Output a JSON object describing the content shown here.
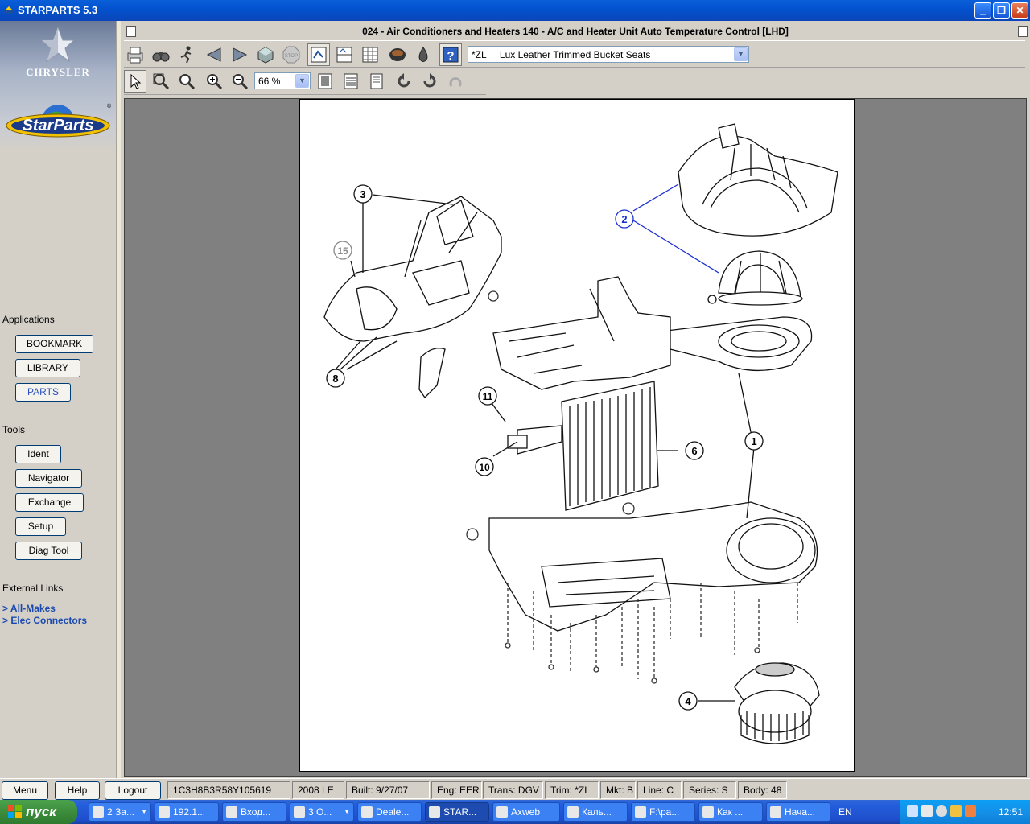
{
  "window": {
    "title": "STARPARTS 5.3",
    "min": "_",
    "max": "❐",
    "close": "✕"
  },
  "brand": {
    "chrysler": "CHRYSLER",
    "starparts": "StarParts"
  },
  "left": {
    "applications_label": "Applications",
    "applications": [
      "BOOKMARK",
      "LIBRARY",
      "PARTS"
    ],
    "tools_label": "Tools",
    "tools": [
      "Ident",
      "Navigator",
      "Exchange",
      "Setup",
      "Diag Tool"
    ],
    "external_label": "External Links",
    "external": [
      "> All-Makes",
      "> Elec Connectors"
    ]
  },
  "doc": {
    "title": "024 - Air Conditioners and Heaters   140 - A/C and Heater Unit Auto Temperature Control [LHD]"
  },
  "toolbar": {
    "trim_select": "*ZL     Lux Leather Trimmed Bucket Seats",
    "zoom": "66 %"
  },
  "diagram": {
    "callouts": [
      "3",
      "15",
      "2",
      "8",
      "11",
      "10",
      "6",
      "1",
      "4"
    ]
  },
  "status": {
    "menu": "Menu",
    "help": "Help",
    "logout": "Logout",
    "vin": "1C3H8B3R58Y105619",
    "year_model": "2008 LE",
    "built": "Built: 9/27/07",
    "eng": "Eng: EER",
    "trans": "Trans: DGV",
    "trim": "Trim: *ZL",
    "mkt": "Mkt: B",
    "line": "Line: C",
    "series": "Series: S",
    "body": "Body: 48"
  },
  "taskbar": {
    "start": "пуск",
    "tasks": [
      "2 За...",
      "192.1...",
      "Вход...",
      "3 О...",
      "Deale...",
      "STAR...",
      "Axweb",
      "Каль...",
      "F:\\ра...",
      "Как ...",
      "Нача..."
    ],
    "lang": "EN",
    "clock": "12:51"
  },
  "colors": {
    "titlebar": "#0352d0",
    "callout_blue": "#1a2fd0",
    "taskbar": "#245edb"
  }
}
